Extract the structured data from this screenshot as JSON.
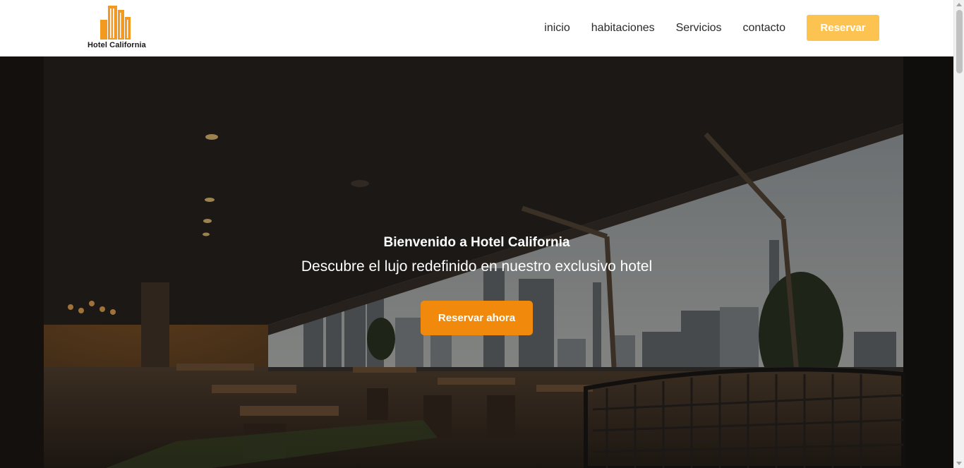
{
  "brand": {
    "name": "Hotel California",
    "logo_color": "#f39a1e"
  },
  "nav": {
    "items": [
      {
        "label": "inicio"
      },
      {
        "label": "habitaciones"
      },
      {
        "label": "Servicios"
      },
      {
        "label": "contacto"
      }
    ],
    "reserve_label": "Reservar",
    "reserve_color": "#fcc351"
  },
  "hero": {
    "title": "Bienvenido a Hotel California",
    "subtitle": "Descubre el lujo redefinido en nuestro exclusivo hotel",
    "cta_label": "Reservar ahora",
    "cta_color": "#f18a0c"
  }
}
